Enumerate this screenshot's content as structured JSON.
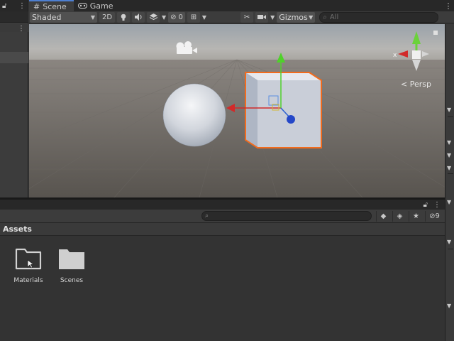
{
  "tabs": [
    {
      "label": "Scene",
      "icon": "grid-icon",
      "active": true
    },
    {
      "label": "Game",
      "icon": "gamepad-icon",
      "active": false
    }
  ],
  "toolbar": {
    "shading_mode": "Shaded",
    "mode_2d": "2D",
    "hidden_count": "0",
    "gizmos_label": "Gizmos",
    "search_placeholder": "All"
  },
  "scene": {
    "persp_label": "Persp",
    "gizmo_axis_label": "x",
    "objects": [
      "camera-icon",
      "sphere",
      "cube"
    ]
  },
  "project": {
    "breadcrumb": "Assets",
    "hidden_count": "9",
    "items": [
      {
        "label": "Materials",
        "icon": "folder-icon"
      },
      {
        "label": "Scenes",
        "icon": "folder-icon"
      }
    ]
  },
  "colors": {
    "accent": "#4d7fd1",
    "selection_outline": "#f26b1d",
    "axis_x": "#d12a2a",
    "axis_y": "#4fd12a",
    "axis_z": "#2a5fd1"
  }
}
